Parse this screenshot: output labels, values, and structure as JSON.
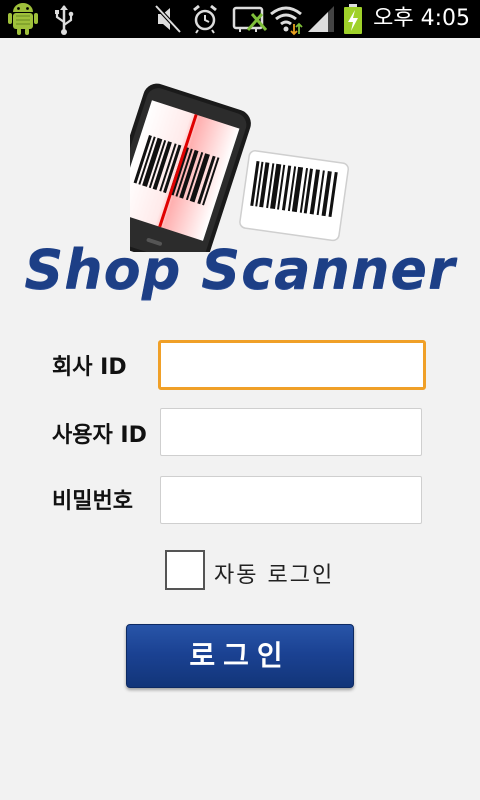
{
  "status_bar": {
    "icons": [
      "android-debug-icon",
      "usb-icon",
      "mute-icon",
      "alarm-icon",
      "screen-mirror-icon",
      "wifi-icon",
      "signal-icon",
      "battery-charging-icon"
    ],
    "time": "오후 4:05"
  },
  "header": {
    "logo_icon": "barcode-phone-scanner-logo",
    "title": "Shop Scanner"
  },
  "form": {
    "company_id_label": "회사 ID",
    "company_id_value": "",
    "user_id_label": "사용자 ID",
    "user_id_value": "",
    "password_label": "비밀번호",
    "password_value": ""
  },
  "auto_login": {
    "label": "자동 로그인",
    "checked": false
  },
  "login_button": {
    "label": "로그인"
  },
  "colors": {
    "title": "#1d3f86",
    "button": "#1b4293",
    "focus_border": "#f0a028",
    "background": "#f2f2f2"
  }
}
